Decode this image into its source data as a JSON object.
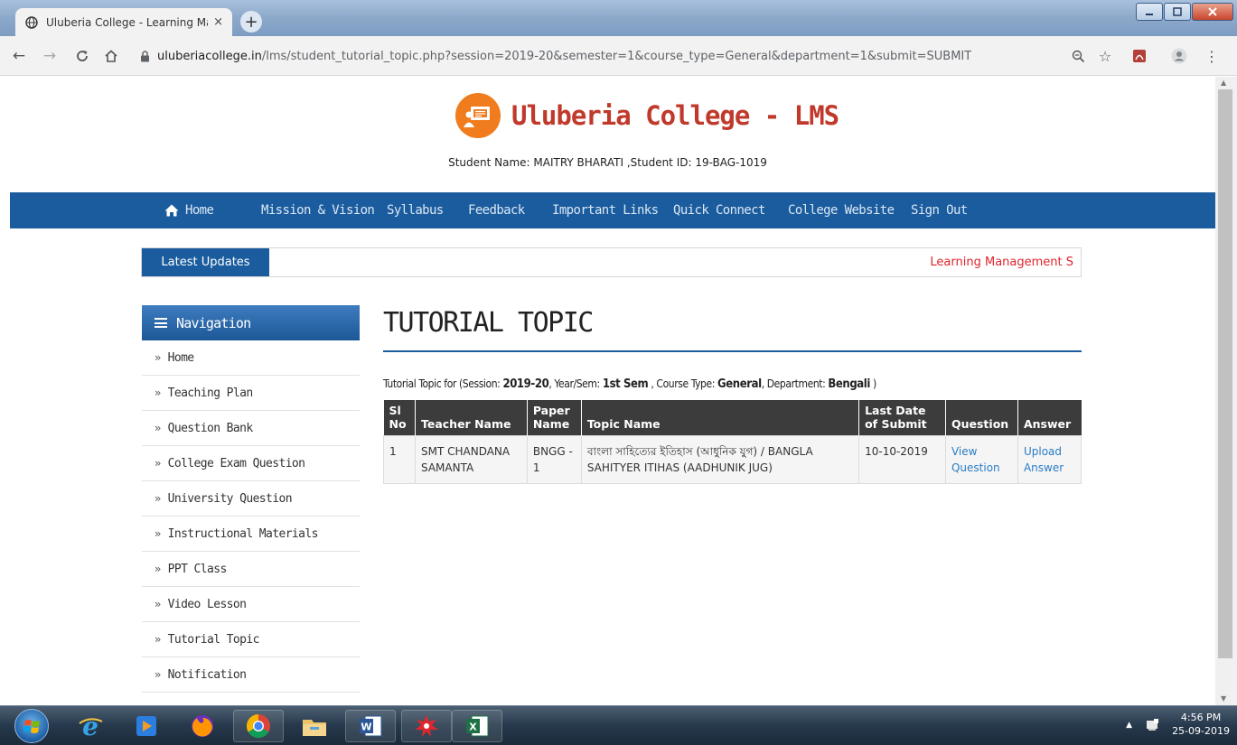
{
  "browser": {
    "tab_title": "Uluberia College - Learning Mana",
    "tab_close": "×",
    "new_tab": "+",
    "url_host": "uluberiacollege.in",
    "url_path": "/lms/student_tutorial_topic.php?session=2019-20&semester=1&course_type=General&department=1&submit=SUBMIT"
  },
  "site": {
    "title": "Uluberia College - LMS",
    "student_line": "Student Name: MAITRY BHARATI ,Student ID: 19-BAG-1019"
  },
  "main_nav": {
    "items": [
      {
        "label": "Home"
      },
      {
        "label": "Mission & Vision"
      },
      {
        "label": "Syllabus"
      },
      {
        "label": "Feedback"
      },
      {
        "label": "Important Links"
      },
      {
        "label": "Quick Connect"
      },
      {
        "label": "College Website"
      },
      {
        "label": "Sign Out"
      }
    ]
  },
  "updates": {
    "label": "Latest Updates",
    "marquee": "Learning Management S"
  },
  "sidenav": {
    "title": "Navigation",
    "items": [
      {
        "label": "Home"
      },
      {
        "label": "Teaching Plan"
      },
      {
        "label": "Question Bank"
      },
      {
        "label": "College Exam Question"
      },
      {
        "label": "University Question"
      },
      {
        "label": "Instructional Materials"
      },
      {
        "label": "PPT Class"
      },
      {
        "label": "Video Lesson"
      },
      {
        "label": "Tutorial Topic"
      },
      {
        "label": "Notification"
      }
    ]
  },
  "content": {
    "heading": "TUTORIAL TOPIC",
    "info_prefix": "Tutorial Topic for (Session: ",
    "session": "2019-20",
    "sem_prefix": ", Year/Sem: ",
    "semester": "1st Sem",
    "type_prefix": " , Course Type: ",
    "course_type": "General",
    "dept_prefix": ", Department: ",
    "department": "Bengali",
    "info_suffix": " )",
    "table": {
      "headers": {
        "sl_no": "Sl No",
        "teacher": "Teacher Name",
        "paper": "Paper Name",
        "topic": "Topic Name",
        "last_date": "Last Date of Submit",
        "question": "Question",
        "answer": "Answer"
      },
      "rows": [
        {
          "sl_no": "1",
          "teacher": "SMT CHANDANA SAMANTA",
          "paper": "BNGG - 1",
          "topic": "বাংলা সাহিত্যের ইতিহাস (আধুনিক যুগ) / BANGLA SAHITYER ITIHAS (AADHUNIK JUG)",
          "last_date": "10-10-2019",
          "question_link": "View Question",
          "answer_link": "Upload Answer"
        }
      ]
    }
  },
  "taskbar": {
    "time": "4:56 PM",
    "date": "25-09-2019"
  },
  "colors": {
    "nav_blue": "#1b5c9e",
    "title_red": "#c0392b",
    "logo_orange": "#f07c1d",
    "link_blue": "#2a7cc6",
    "table_header": "#3c3c3c",
    "marquee_red": "#e0232b"
  }
}
